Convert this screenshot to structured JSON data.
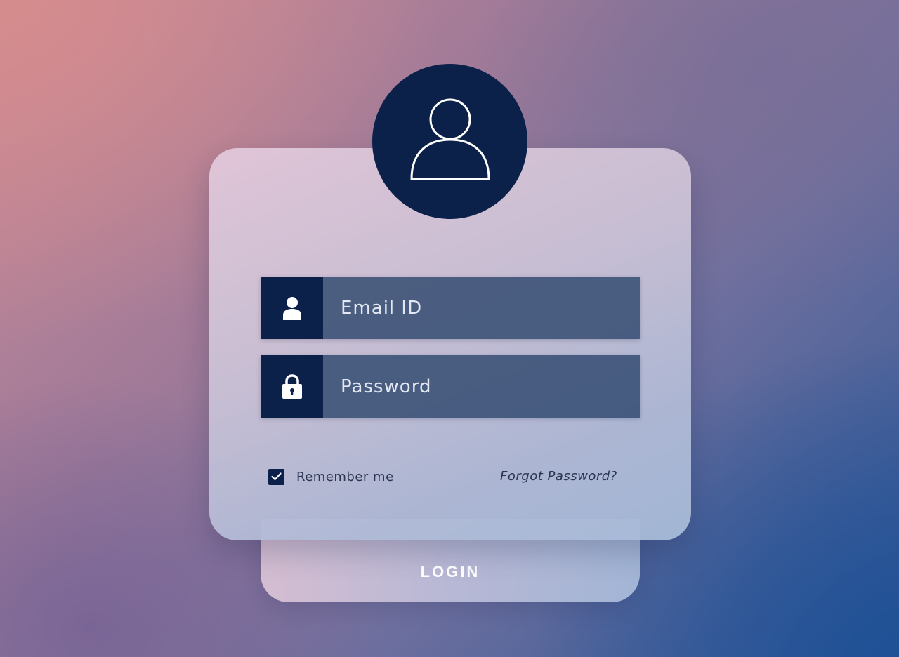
{
  "login_form": {
    "email": {
      "placeholder": "Email ID",
      "value": "",
      "icon": "user-icon"
    },
    "password": {
      "placeholder": "Password",
      "value": "",
      "icon": "lock-icon"
    },
    "remember_me": {
      "label": "Remember me",
      "checked": true
    },
    "forgot_password_label": "Forgot Password?",
    "login_button_label": "LOGIN",
    "avatar_icon": "user-icon"
  },
  "colors": {
    "navy": "#0b214a",
    "field_fill": "#2e486e",
    "text_dark": "#2a3550",
    "white": "#ffffff"
  }
}
